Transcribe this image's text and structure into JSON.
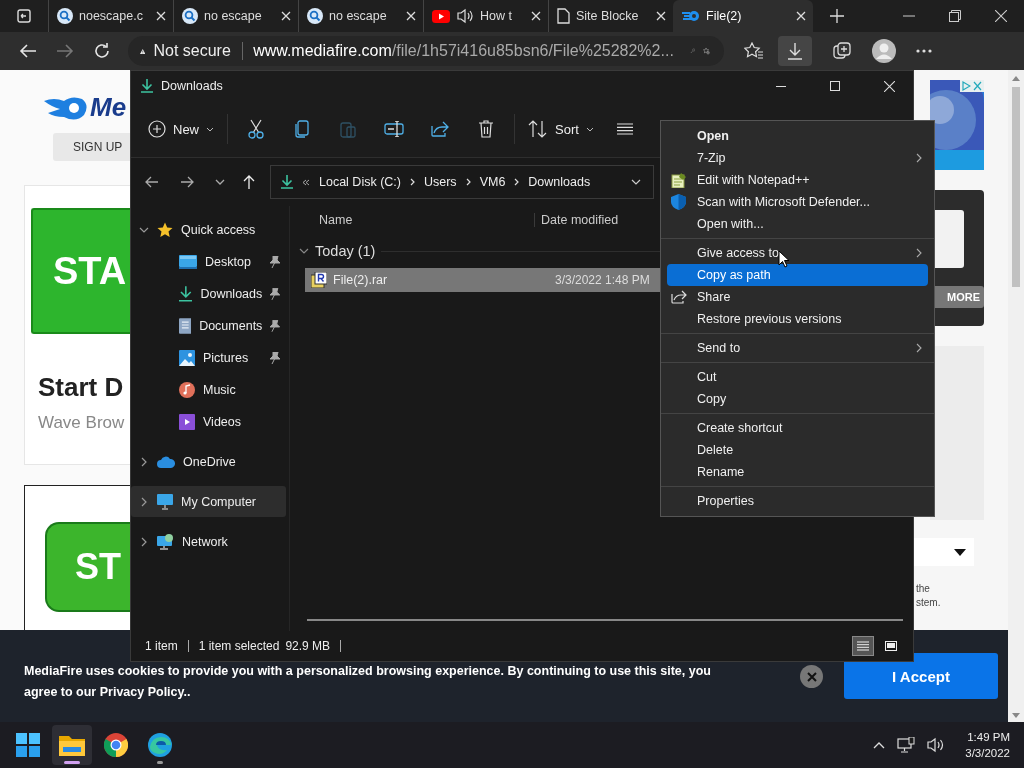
{
  "browser": {
    "tabs": [
      {
        "title": "noescape.c",
        "kind": "search",
        "audio": false,
        "selected": false
      },
      {
        "title": "no escape",
        "kind": "search",
        "audio": false,
        "selected": false
      },
      {
        "title": "no escape",
        "kind": "search",
        "audio": false,
        "selected": false
      },
      {
        "title": "How t",
        "kind": "youtube",
        "audio": true,
        "selected": false
      },
      {
        "title": "Site Blocke",
        "kind": "page",
        "audio": false,
        "selected": false
      },
      {
        "title": "File(2)",
        "kind": "mediafire",
        "audio": false,
        "selected": true
      }
    ],
    "address": {
      "security": "Not secure",
      "host": "www.mediafire.com",
      "path": "/file/1h57i416u85bsn6/File%25282%2..."
    }
  },
  "webpage": {
    "logo_text": "Me",
    "sign_up": "SIGN UP",
    "start_button": "STA",
    "heading": "Start D",
    "subheading": "Wave Brow",
    "start_button_2": "ST",
    "more_button": "MORE",
    "side_text": [
      "the",
      "stem."
    ]
  },
  "explorer": {
    "title": "Downloads",
    "toolbar": [
      {
        "kind": "new",
        "label": "New",
        "disabled": false
      },
      {
        "kind": "cut",
        "disabled": false
      },
      {
        "kind": "copy",
        "disabled": false
      },
      {
        "kind": "paste",
        "disabled": true
      },
      {
        "kind": "rename",
        "disabled": false
      },
      {
        "kind": "share",
        "disabled": false
      },
      {
        "kind": "delete",
        "disabled": false
      },
      {
        "kind": "sort",
        "label": "Sort",
        "disabled": false
      },
      {
        "kind": "view",
        "disabled": false
      }
    ],
    "path": [
      "Local Disk (C:)",
      "Users",
      "VM6",
      "Downloads"
    ],
    "tree": [
      {
        "label": "Quick access",
        "kind": "star",
        "expanded": true,
        "selected": false,
        "children": [
          {
            "label": "Desktop",
            "kind": "desktop",
            "pinned": true,
            "selected": false
          },
          {
            "label": "Downloads",
            "kind": "downloads",
            "pinned": true,
            "selected": false
          },
          {
            "label": "Documents",
            "kind": "documents",
            "pinned": true,
            "selected": false
          },
          {
            "label": "Pictures",
            "kind": "pictures",
            "pinned": true,
            "selected": false
          },
          {
            "label": "Music",
            "kind": "music",
            "pinned": false,
            "selected": false
          },
          {
            "label": "Videos",
            "kind": "videos",
            "pinned": false,
            "selected": false
          }
        ]
      },
      {
        "label": "OneDrive",
        "kind": "cloud",
        "expanded": false,
        "selected": false
      },
      {
        "label": "My Computer",
        "kind": "computer",
        "expanded": false,
        "selected": true
      },
      {
        "label": "Network",
        "kind": "network",
        "expanded": false,
        "selected": false
      }
    ],
    "columns": [
      "Name",
      "Date modified"
    ],
    "groups": [
      {
        "label": "Today (1)",
        "expanded": true,
        "files": [
          {
            "name": "File(2).rar",
            "date": "3/3/2022 1:48 PM",
            "selected": true
          }
        ]
      }
    ],
    "status": {
      "count": "1 item",
      "selection": "1 item selected",
      "size": "92.9 MB",
      "views": [
        {
          "kind": "details",
          "selected": true
        },
        {
          "kind": "tiles",
          "selected": false
        }
      ]
    }
  },
  "context_menu": [
    {
      "label": "Open",
      "kind": "default",
      "selected": false
    },
    {
      "label": "7-Zip",
      "kind": "submenu",
      "selected": false
    },
    {
      "label": "Edit with Notepad++",
      "kind": "notepad",
      "selected": false
    },
    {
      "label": "Scan with Microsoft Defender...",
      "kind": "defender",
      "selected": false
    },
    {
      "label": "Open with...",
      "kind": "plain",
      "selected": false
    },
    {
      "kind": "separator"
    },
    {
      "label": "Give access to",
      "kind": "submenu",
      "selected": false
    },
    {
      "label": "Copy as path",
      "kind": "plain",
      "selected": true
    },
    {
      "label": "Share",
      "kind": "share",
      "selected": false
    },
    {
      "label": "Restore previous versions",
      "kind": "plain",
      "selected": false
    },
    {
      "kind": "separator"
    },
    {
      "label": "Send to",
      "kind": "submenu",
      "selected": false
    },
    {
      "kind": "separator"
    },
    {
      "label": "Cut",
      "kind": "plain",
      "selected": false
    },
    {
      "label": "Copy",
      "kind": "plain",
      "selected": false
    },
    {
      "kind": "separator"
    },
    {
      "label": "Create shortcut",
      "kind": "plain",
      "selected": false
    },
    {
      "label": "Delete",
      "kind": "plain",
      "selected": false
    },
    {
      "label": "Rename",
      "kind": "plain",
      "selected": false
    },
    {
      "kind": "separator"
    },
    {
      "label": "Properties",
      "kind": "plain",
      "selected": false
    }
  ],
  "cookie_banner": {
    "text": "MediaFire uses cookies to provide you with a personalized browsing experience. By continuing to use this site, you agree to our Privacy Policy..",
    "accept": "I Accept"
  },
  "taskbar": {
    "apps": [
      {
        "kind": "start",
        "active": false,
        "running": false
      },
      {
        "kind": "explorer",
        "active": true,
        "running": true
      },
      {
        "kind": "chrome",
        "active": false,
        "running": false
      },
      {
        "kind": "edge",
        "active": false,
        "running": true
      }
    ],
    "time": "1:49 PM",
    "date": "3/3/2022"
  }
}
